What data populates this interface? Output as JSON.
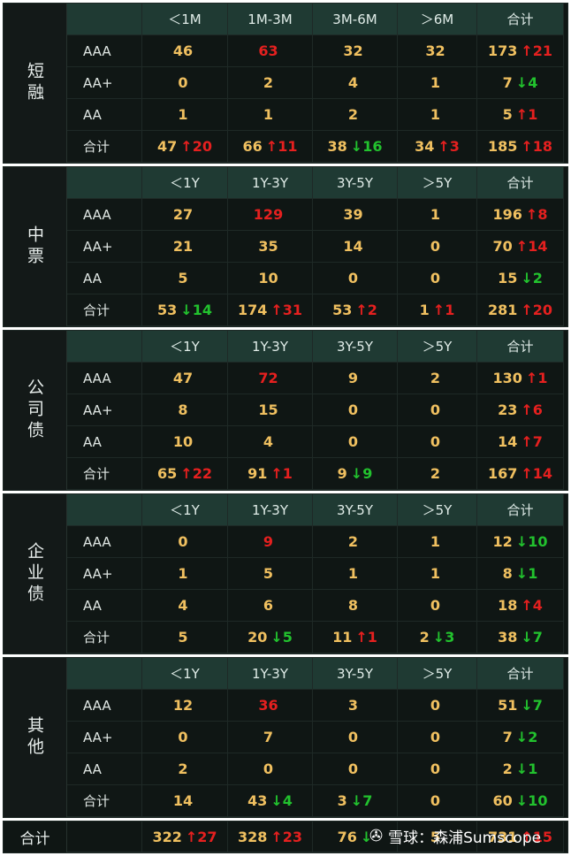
{
  "colors": {
    "up": "#e5201f",
    "down": "#22c22e",
    "value": "#f0c060",
    "header_bg": "#1f3a33"
  },
  "sections": [
    {
      "label": "短融",
      "headers": [
        "＜1M",
        "1M-3M",
        "3M-6M",
        "＞6M",
        "合计"
      ],
      "rows": [
        {
          "label": "AAA",
          "cells": [
            "46",
            "63",
            "32",
            "32",
            "173"
          ],
          "red": [
            1
          ],
          "chg": {
            "text": "↑21",
            "dir": "up"
          }
        },
        {
          "label": "AA+",
          "cells": [
            "0",
            "2",
            "4",
            "1",
            "7"
          ],
          "red": [],
          "chg": {
            "text": "↓4",
            "dir": "down"
          }
        },
        {
          "label": "AA",
          "cells": [
            "1",
            "1",
            "2",
            "1",
            "5"
          ],
          "red": [],
          "chg": {
            "text": "↑1",
            "dir": "up"
          }
        },
        {
          "label": "合计",
          "cells": [
            "47",
            "66",
            "38",
            "34",
            "185"
          ],
          "red": [],
          "cell_chg": [
            {
              "text": "↑20",
              "dir": "up"
            },
            {
              "text": "↑11",
              "dir": "up"
            },
            {
              "text": "↓16",
              "dir": "down"
            },
            {
              "text": "↑3",
              "dir": "up"
            }
          ],
          "chg": {
            "text": "↑18",
            "dir": "up"
          }
        }
      ]
    },
    {
      "label": "中票",
      "headers": [
        "＜1Y",
        "1Y-3Y",
        "3Y-5Y",
        "＞5Y",
        "合计"
      ],
      "rows": [
        {
          "label": "AAA",
          "cells": [
            "27",
            "129",
            "39",
            "1",
            "196"
          ],
          "red": [
            1
          ],
          "chg": {
            "text": "↑8",
            "dir": "up"
          }
        },
        {
          "label": "AA+",
          "cells": [
            "21",
            "35",
            "14",
            "0",
            "70"
          ],
          "red": [],
          "chg": {
            "text": "↑14",
            "dir": "up"
          }
        },
        {
          "label": "AA",
          "cells": [
            "5",
            "10",
            "0",
            "0",
            "15"
          ],
          "red": [],
          "chg": {
            "text": "↓2",
            "dir": "down"
          }
        },
        {
          "label": "合计",
          "cells": [
            "53",
            "174",
            "53",
            "1",
            "281"
          ],
          "red": [],
          "cell_chg": [
            {
              "text": "↓14",
              "dir": "down"
            },
            {
              "text": "↑31",
              "dir": "up"
            },
            {
              "text": "↑2",
              "dir": "up"
            },
            {
              "text": "↑1",
              "dir": "up"
            }
          ],
          "chg": {
            "text": "↑20",
            "dir": "up"
          }
        }
      ]
    },
    {
      "label": "公司债",
      "headers": [
        "＜1Y",
        "1Y-3Y",
        "3Y-5Y",
        "＞5Y",
        "合计"
      ],
      "rows": [
        {
          "label": "AAA",
          "cells": [
            "47",
            "72",
            "9",
            "2",
            "130"
          ],
          "red": [
            1
          ],
          "chg": {
            "text": "↑1",
            "dir": "up"
          }
        },
        {
          "label": "AA+",
          "cells": [
            "8",
            "15",
            "0",
            "0",
            "23"
          ],
          "red": [],
          "chg": {
            "text": "↑6",
            "dir": "up"
          }
        },
        {
          "label": "AA",
          "cells": [
            "10",
            "4",
            "0",
            "0",
            "14"
          ],
          "red": [],
          "chg": {
            "text": "↑7",
            "dir": "up"
          }
        },
        {
          "label": "合计",
          "cells": [
            "65",
            "91",
            "9",
            "2",
            "167"
          ],
          "red": [],
          "cell_chg": [
            {
              "text": "↑22",
              "dir": "up"
            },
            {
              "text": "↑1",
              "dir": "up"
            },
            {
              "text": "↓9",
              "dir": "down"
            },
            {
              "text": "",
              "dir": "up"
            }
          ],
          "chg": {
            "text": "↑14",
            "dir": "up"
          }
        }
      ]
    },
    {
      "label": "企业债",
      "headers": [
        "＜1Y",
        "1Y-3Y",
        "3Y-5Y",
        "＞5Y",
        "合计"
      ],
      "rows": [
        {
          "label": "AAA",
          "cells": [
            "0",
            "9",
            "2",
            "1",
            "12"
          ],
          "red": [
            1
          ],
          "chg": {
            "text": "↓10",
            "dir": "down"
          }
        },
        {
          "label": "AA+",
          "cells": [
            "1",
            "5",
            "1",
            "1",
            "8"
          ],
          "red": [],
          "chg": {
            "text": "↓1",
            "dir": "down"
          }
        },
        {
          "label": "AA",
          "cells": [
            "4",
            "6",
            "8",
            "0",
            "18"
          ],
          "red": [],
          "chg": {
            "text": "↑4",
            "dir": "up"
          }
        },
        {
          "label": "合计",
          "cells": [
            "5",
            "20",
            "11",
            "2",
            "38"
          ],
          "red": [],
          "cell_chg": [
            {
              "text": "",
              "dir": "up"
            },
            {
              "text": "↓5",
              "dir": "down"
            },
            {
              "text": "↑1",
              "dir": "up"
            },
            {
              "text": "↓3",
              "dir": "down"
            }
          ],
          "chg": {
            "text": "↓7",
            "dir": "down"
          }
        }
      ]
    },
    {
      "label": "其他",
      "headers": [
        "＜1Y",
        "1Y-3Y",
        "3Y-5Y",
        "＞5Y",
        "合计"
      ],
      "rows": [
        {
          "label": "AAA",
          "cells": [
            "12",
            "36",
            "3",
            "0",
            "51"
          ],
          "red": [
            1
          ],
          "chg": {
            "text": "↓7",
            "dir": "down"
          }
        },
        {
          "label": "AA+",
          "cells": [
            "0",
            "7",
            "0",
            "0",
            "7"
          ],
          "red": [],
          "chg": {
            "text": "↓2",
            "dir": "down"
          }
        },
        {
          "label": "AA",
          "cells": [
            "2",
            "0",
            "0",
            "0",
            "2"
          ],
          "red": [],
          "chg": {
            "text": "↓1",
            "dir": "down"
          }
        },
        {
          "label": "合计",
          "cells": [
            "14",
            "43",
            "3",
            "0",
            "60"
          ],
          "red": [],
          "cell_chg": [
            {
              "text": "",
              "dir": "up"
            },
            {
              "text": "↓4",
              "dir": "down"
            },
            {
              "text": "↓7",
              "dir": "down"
            },
            {
              "text": "",
              "dir": "up"
            }
          ],
          "chg": {
            "text": "↓10",
            "dir": "down"
          }
        }
      ]
    }
  ],
  "grand_total": {
    "label": "合计",
    "cells": [
      {
        "value": "322",
        "chg": "↑27",
        "dir": "up"
      },
      {
        "value": "328",
        "chg": "↑23",
        "dir": "up"
      },
      {
        "value": "76",
        "chg": "↓",
        "dir": "down"
      },
      {
        "value": "5",
        "chg": "",
        "dir": "up"
      },
      {
        "value": "731",
        "chg": "↑15",
        "dir": "up"
      }
    ]
  },
  "watermark": {
    "icon": "snowball-logo-icon",
    "text": "雪球：森浦Sumscope"
  }
}
